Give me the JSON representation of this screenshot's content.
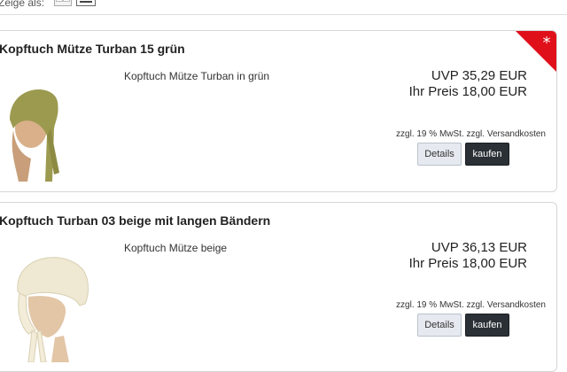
{
  "toolbar": {
    "view_label": "Zeige als:",
    "sort_dots": "• • •"
  },
  "products": [
    {
      "title": "Kopftuch Mütze Turban 15 grün",
      "description": "Kopftuch Mütze Turban in grün",
      "uvp": "UVP 35,29 EUR",
      "price": "Ihr Preis 18,00 EUR",
      "tax_note": "zzgl. 19 % MwSt. zzgl. Versandkosten",
      "details_label": "Details",
      "buy_label": "kaufen",
      "badge_symbol": "*",
      "badge_color": "#e0101a",
      "image_color": "#9c9a4f"
    },
    {
      "title": "Kopftuch Turban 03 beige mit langen Bändern",
      "description": "Kopftuch Mütze beige",
      "uvp": "UVP 36,13 EUR",
      "price": "Ihr Preis 18,00 EUR",
      "tax_note": "zzgl. 19 % MwSt. zzgl. Versandkosten",
      "details_label": "Details",
      "buy_label": "kaufen",
      "image_color": "#efe8d2"
    }
  ]
}
